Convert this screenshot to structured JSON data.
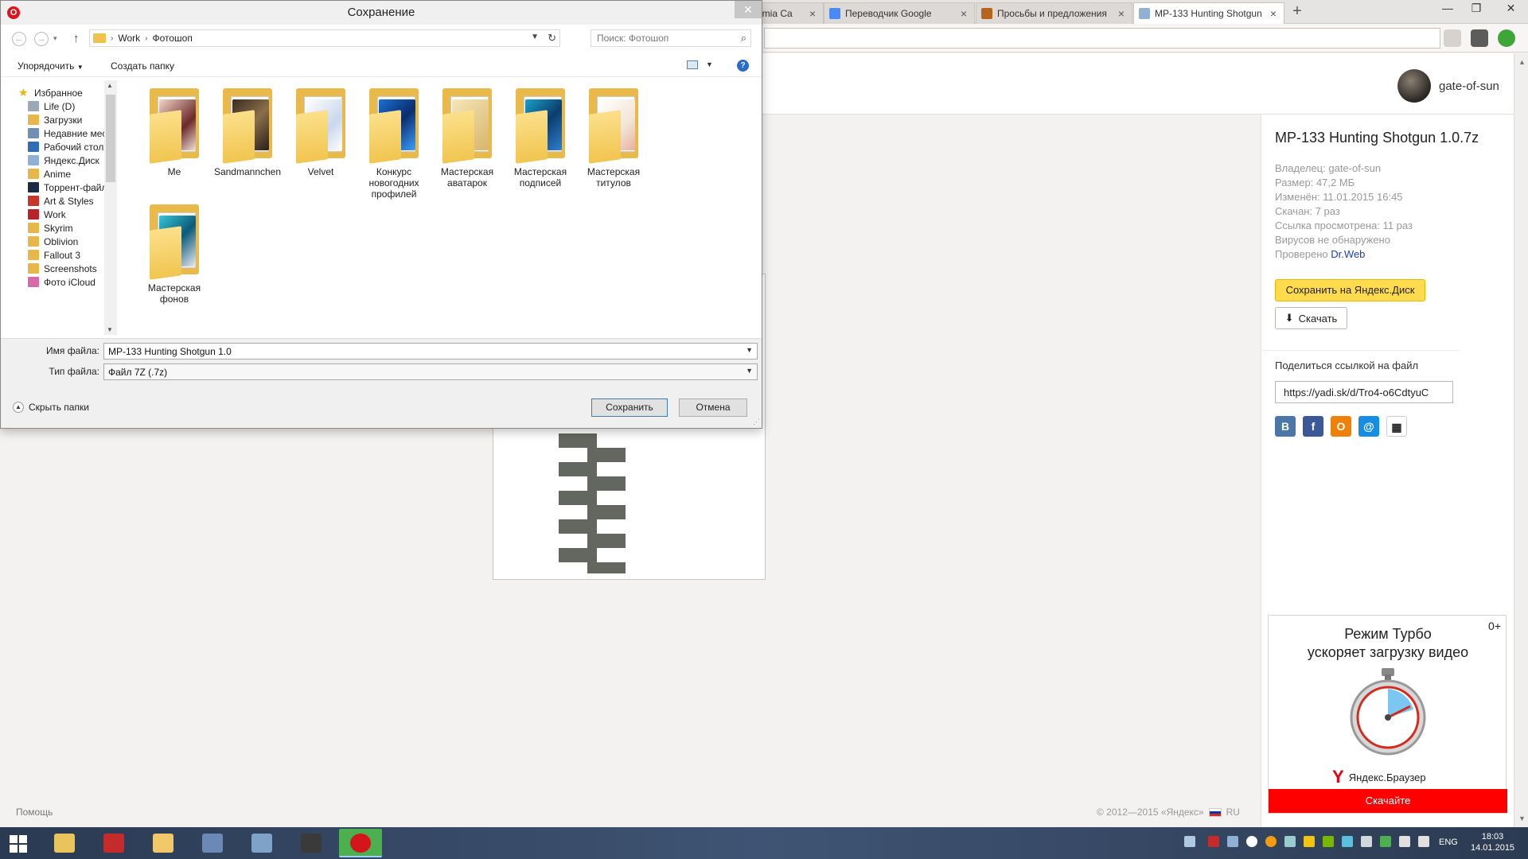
{
  "browser": {
    "tabs": [
      {
        "label": "ermia Ca",
        "icon": "page-icon"
      },
      {
        "label": "Переводчик Google",
        "icon": "google-translate-icon"
      },
      {
        "label": "Просьбы и предложения",
        "icon": "forum-icon"
      },
      {
        "label": "MP-133 Hunting Shotgun",
        "icon": "yandex-disk-icon",
        "active": true
      }
    ]
  },
  "page": {
    "username": "gate-of-sun",
    "file_title": "MP-133 Hunting Shotgun 1.0.7z",
    "meta": {
      "owner": "Владелец: gate-of-sun",
      "size": "Размер: 47,2 МБ",
      "modified": "Изменён: 11.01.2015 16:45",
      "downloaded": "Скачан: 7 раз",
      "viewed": "Ссылка просмотрена: 11 раз",
      "virus": "Вирусов не обнаружено",
      "checked_prefix": "Проверено",
      "checked_link": "Dr.Web"
    },
    "save_to_disk": "Сохранить на Яндекс.Диск",
    "download": "Скачать",
    "share_label": "Поделиться ссылкой на файл",
    "share_url": "https://yadi.sk/d/Tro4-o6CdtyuC",
    "social": [
      {
        "name": "vk",
        "glyph": "В",
        "color": "#4a76a8"
      },
      {
        "name": "facebook",
        "glyph": "f",
        "color": "#3b5998"
      },
      {
        "name": "odnoklassniki",
        "glyph": "О",
        "color": "#ee8208"
      },
      {
        "name": "mail",
        "glyph": "@",
        "color": "#168de2"
      },
      {
        "name": "qr",
        "glyph": "▦",
        "color": "#ffffff"
      }
    ],
    "ad": {
      "age": "0+",
      "line1": "Режим Турбо",
      "line2": "ускоряет загрузку видео",
      "brand": "Яндекс.Браузер",
      "cta": "Скачайте"
    },
    "footer_help": "Помощь",
    "footer_copy": "© 2012—2015 «Яндекс»",
    "footer_lang": "RU"
  },
  "dialog": {
    "title": "Сохранение",
    "breadcrumb": [
      "Work",
      "Фотошоп"
    ],
    "search_placeholder": "Поиск: Фотошоп",
    "organize": "Упорядочить",
    "new_folder": "Создать папку",
    "nav_items": [
      {
        "label": "Избранное",
        "icon": "star-icon",
        "color": "#f3b400"
      },
      {
        "label": "Life (D)",
        "icon": "drive-icon",
        "color": "#9aa8b8"
      },
      {
        "label": "Загрузки",
        "icon": "downloads-icon",
        "color": "#e8b74a"
      },
      {
        "label": "Недавние места",
        "icon": "recent-places-icon",
        "color": "#6f8fb5"
      },
      {
        "label": "Рабочий стол",
        "icon": "desktop-icon",
        "color": "#2f6db5"
      },
      {
        "label": "Яндекс.Диск",
        "icon": "yandex-disk-icon",
        "color": "#8fb1d6"
      },
      {
        "label": "Anime",
        "icon": "folder-icon",
        "color": "#e8b74a"
      },
      {
        "label": "Торрент-файлы",
        "icon": "torrent-icon",
        "color": "#1d2a44"
      },
      {
        "label": "Art & Styles",
        "icon": "art-icon",
        "color": "#c9342b"
      },
      {
        "label": "Work",
        "icon": "work-icon",
        "color": "#b8242a"
      },
      {
        "label": "Skyrim",
        "icon": "folder-icon",
        "color": "#e8b74a"
      },
      {
        "label": "Oblivion",
        "icon": "folder-icon",
        "color": "#e8b74a"
      },
      {
        "label": "Fallout 3",
        "icon": "folder-icon",
        "color": "#e8b74a"
      },
      {
        "label": "Screenshots",
        "icon": "folder-icon",
        "color": "#e8b74a"
      },
      {
        "label": "Фото iCloud",
        "icon": "icloud-photos-icon",
        "color": "#d96aa8"
      }
    ],
    "files": [
      {
        "label": "Me",
        "art": "linear-gradient(135deg,#f3d6c6,#6b2a2a 60%,#f0e2dc)"
      },
      {
        "label": "Sandmannchen",
        "art": "linear-gradient(135deg,#3a2c22,#8a6f4a 50%,#2a1f18)"
      },
      {
        "label": "Velvet",
        "art": "linear-gradient(135deg,#ffffff,#c9d8ee 60%,#ffffff)"
      },
      {
        "label": "Конкурс новогодних профилей",
        "art": "linear-gradient(135deg,#1a6fd1,#0b2d6e 50%,#39a0ff)"
      },
      {
        "label": "Мастерская аватарок",
        "art": "linear-gradient(135deg,#f5e6b8,#d8b56a)"
      },
      {
        "label": "Мастерская подписей",
        "art": "linear-gradient(135deg,#1aa0c8,#0b3d6e 50%,#2e7fd1)"
      },
      {
        "label": "Мастерская титулов",
        "art": "linear-gradient(135deg,#ffffff,#f2e6d6 60%,#e8b0a0)"
      },
      {
        "label": "Мастерская фонов",
        "art": "linear-gradient(135deg,#35c7d8,#0b5a78 50%,#e8e8f0)"
      }
    ],
    "file_name_label": "Имя файла:",
    "file_name": "MP-133 Hunting Shotgun 1.0",
    "file_type_label": "Тип файла:",
    "file_type": "Файл 7Z (.7z)",
    "hide_folders": "Скрыть папки",
    "save": "Сохранить",
    "cancel": "Отмена"
  },
  "taskbar": {
    "language": "ENG",
    "time": "18:03",
    "date": "14.01.2015"
  }
}
